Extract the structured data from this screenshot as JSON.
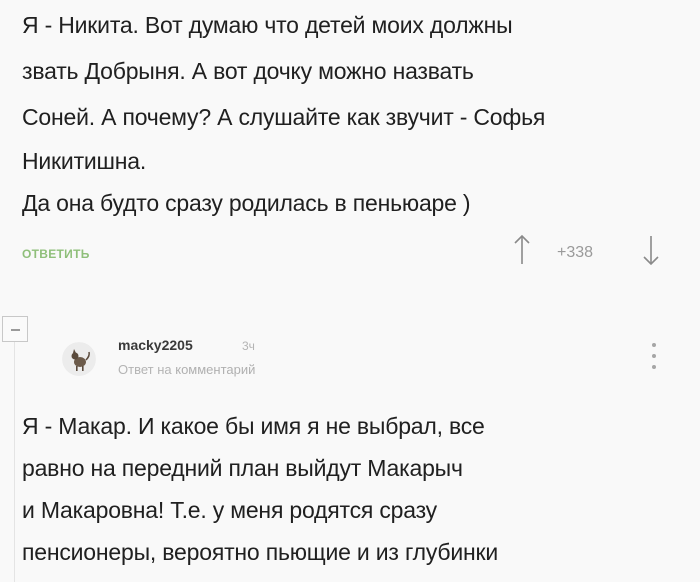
{
  "parent_comment": {
    "lines": [
      "Я - Никита. Вот думаю что детей моих должны",
      "звать Добрыня. А вот дочку можно назвать",
      "Соней. А почему? А слушайте как звучит - Софья",
      "Никитишна.",
      "Да она будто сразу родилась в пеньюаре )"
    ],
    "reply_label": "ОТВЕТИТЬ",
    "rating": "+338",
    "icons": {
      "up": "arrow-up-icon",
      "down": "arrow-down-icon"
    }
  },
  "reply_comment": {
    "username": "macky2205",
    "time": "3ч",
    "meta_prefix": "Ответ на",
    "meta_link": "комментарий",
    "lines": [
      "Я - Макар. И какое бы имя я не выбрал, все",
      "равно на передний план выйдут Макарыч",
      "и Макаровна! Т.е. у меня родятся сразу",
      "пенсионеры, вероятно пьющие и из глубинки"
    ],
    "icons": {
      "collapse": "minus-icon",
      "avatar": "avatar-icon",
      "more": "more-vertical-icon"
    }
  },
  "colors": {
    "background": "#f9f9f9",
    "text": "#202020",
    "reply_link": "#8fbf7a",
    "muted": "#b4b4b4"
  }
}
